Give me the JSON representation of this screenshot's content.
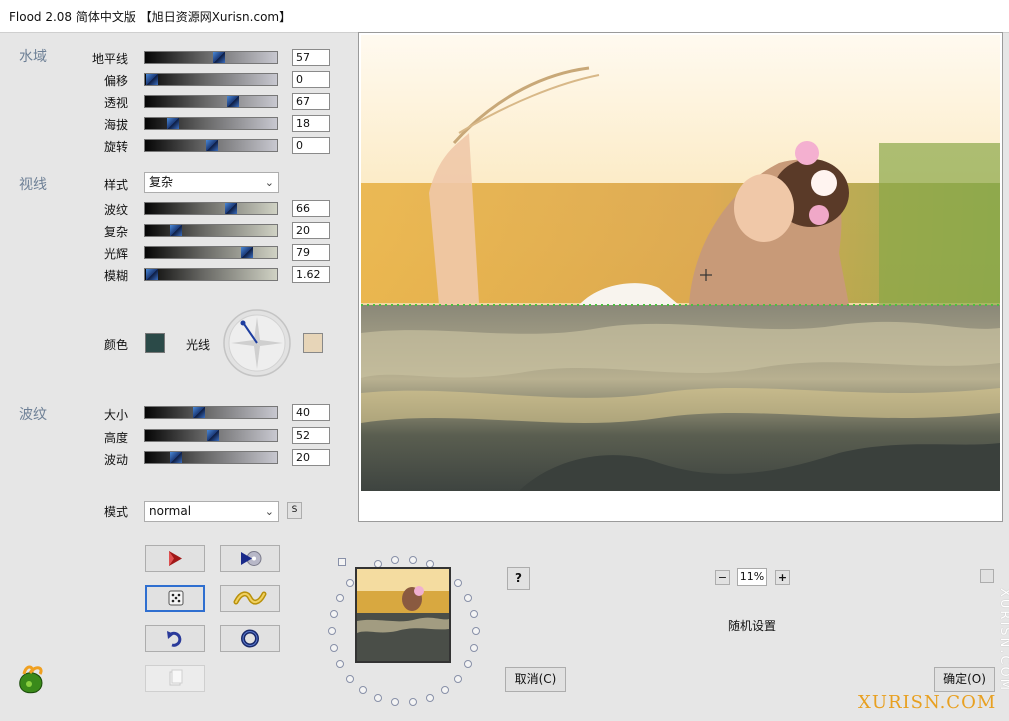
{
  "window": {
    "title": "Flood 2.08 简体中文版 【旭日资源网Xurisn.com】"
  },
  "water": {
    "section": "水域",
    "sliders": [
      {
        "label": "地平线",
        "value": "57"
      },
      {
        "label": "偏移",
        "value": "0"
      },
      {
        "label": "透视",
        "value": "67"
      },
      {
        "label": "海拔",
        "value": "18"
      },
      {
        "label": "旋转",
        "value": "0"
      }
    ]
  },
  "view": {
    "section": "视线",
    "style_label": "样式",
    "style_value": "复杂",
    "sliders": [
      {
        "label": "波纹",
        "value": "66"
      },
      {
        "label": "复杂",
        "value": "20"
      },
      {
        "label": "光辉",
        "value": "79"
      },
      {
        "label": "模糊",
        "value": "1.62"
      }
    ],
    "color_label": "颜色",
    "light_label": "光线",
    "water_color": "#2b4a48",
    "light_color": "#e7d5b8"
  },
  "waves": {
    "section": "波纹",
    "sliders": [
      {
        "label": "大小",
        "value": "40"
      },
      {
        "label": "高度",
        "value": "52"
      },
      {
        "label": "波动",
        "value": "20"
      }
    ]
  },
  "mode": {
    "label": "模式",
    "value": "normal",
    "small_button": "S"
  },
  "zoom": {
    "minus": "−",
    "value": "11%",
    "plus": "+"
  },
  "random_settings": "随机设置",
  "help_label": "?",
  "cancel_label": "取消(C)",
  "ok_label": "确定(O)",
  "watermark": {
    "side": "XURISN.COM",
    "corner": "XURISN.COM"
  }
}
